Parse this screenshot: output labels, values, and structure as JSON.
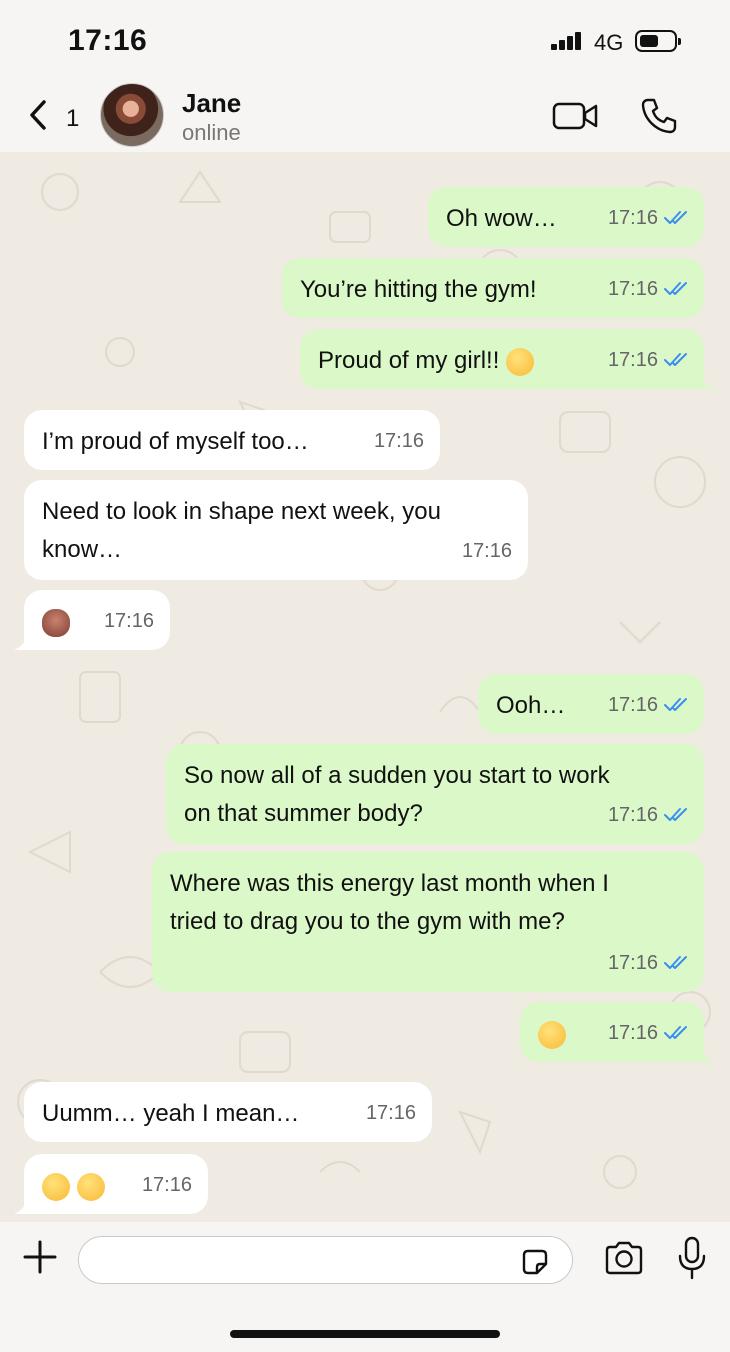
{
  "status_bar": {
    "time": "17:16",
    "network": "4G"
  },
  "header": {
    "back_count": "1",
    "contact_name": "Jane",
    "contact_status": "online"
  },
  "messages": [
    {
      "dir": "out",
      "text": "Oh wow…",
      "time": "17:16"
    },
    {
      "dir": "out",
      "text": "You’re hitting the gym!",
      "time": "17:16"
    },
    {
      "dir": "out",
      "text": "Proud of my girl!!",
      "emoji": [
        "kissing-face"
      ],
      "time": "17:16"
    },
    {
      "dir": "in",
      "text": "I’m proud of myself too…",
      "time": "17:16"
    },
    {
      "dir": "in",
      "text": "Need to look in shape next week, you",
      "text2": "know…",
      "time": "17:16"
    },
    {
      "dir": "in",
      "emoji": [
        "see-no-evil-monkey"
      ],
      "time": "17:16"
    },
    {
      "dir": "out",
      "text": "Ooh…",
      "time": "17:16"
    },
    {
      "dir": "out",
      "text": "So now all of a sudden you start to work",
      "text2": "on that summer body?",
      "time": "17:16"
    },
    {
      "dir": "out",
      "text": "Where was this energy last month when I",
      "text2": "tried to drag you to the gym with me?",
      "time": "17:16"
    },
    {
      "dir": "out",
      "emoji": [
        "winking-face"
      ],
      "time": "17:16"
    },
    {
      "dir": "in",
      "text": "Uumm… yeah I mean…",
      "time": "17:16"
    },
    {
      "dir": "in",
      "emoji": [
        "flushed-face",
        "tears-of-joy-face"
      ],
      "time": "17:16"
    }
  ],
  "colors": {
    "outgoing": "#dbf8c8",
    "incoming": "#ffffff",
    "tick": "#3b8df0",
    "background": "#efeae2"
  },
  "composer": {
    "placeholder": ""
  }
}
